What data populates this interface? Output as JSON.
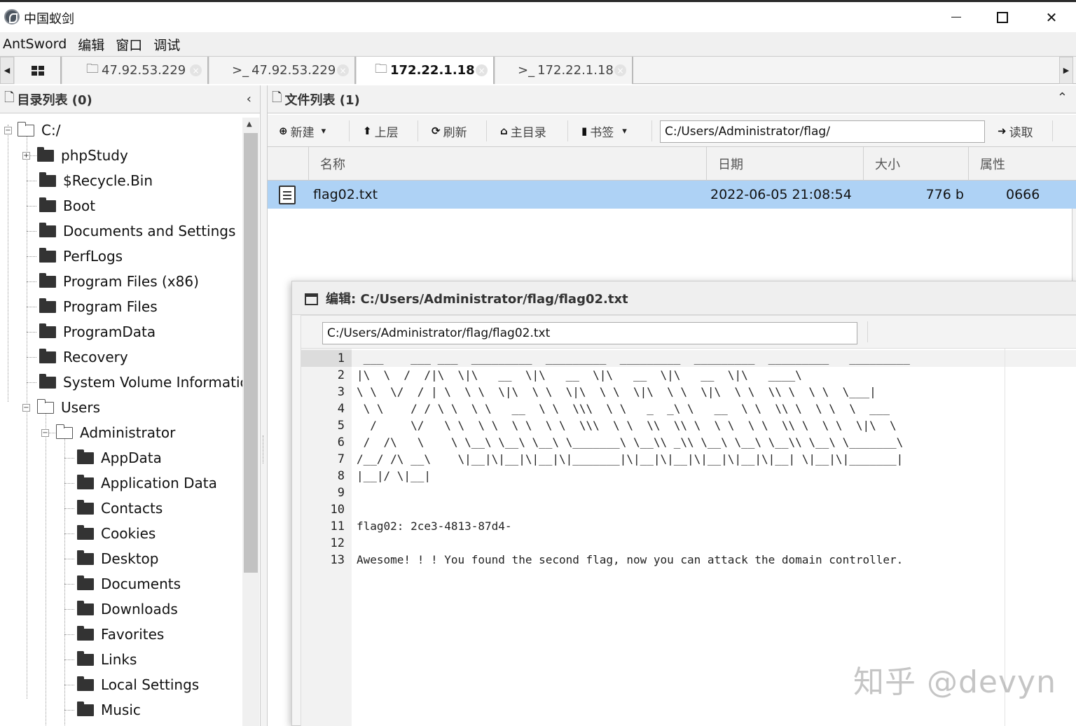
{
  "window": {
    "title": "中国蚁剑",
    "minimize_glyph": "",
    "close_glyph": "✕"
  },
  "menu": [
    "AntSword",
    "编辑",
    "窗口",
    "调试"
  ],
  "tabs": [
    {
      "icon": "🗀",
      "label": "47.92.53.229",
      "close": "×",
      "active": false
    },
    {
      "icon": ">_",
      "label": "47.92.53.229",
      "close": "×",
      "active": false
    },
    {
      "icon": "🗀",
      "label": "172.22.1.18",
      "close": "×",
      "active": true
    },
    {
      "icon": ">_",
      "label": "172.22.1.18",
      "close": "×",
      "active": false
    }
  ],
  "dir_panel": {
    "icon": "🗋",
    "title": "目录列表 (0)",
    "collapse_glyph": "‹"
  },
  "tree": [
    {
      "label": "C:/",
      "level": 0,
      "open": true,
      "expander": "−"
    },
    {
      "label": "phpStudy",
      "level": 1,
      "open": false,
      "expander": "+"
    },
    {
      "label": "$Recycle.Bin",
      "level": 1,
      "open": false
    },
    {
      "label": "Boot",
      "level": 1,
      "open": false
    },
    {
      "label": "Documents and Settings",
      "level": 1,
      "open": false
    },
    {
      "label": "PerfLogs",
      "level": 1,
      "open": false
    },
    {
      "label": "Program Files (x86)",
      "level": 1,
      "open": false
    },
    {
      "label": "Program Files",
      "level": 1,
      "open": false
    },
    {
      "label": "ProgramData",
      "level": 1,
      "open": false
    },
    {
      "label": "Recovery",
      "level": 1,
      "open": false
    },
    {
      "label": "System Volume Information",
      "level": 1,
      "open": false
    },
    {
      "label": "Users",
      "level": 1,
      "open": true,
      "expander": "−"
    },
    {
      "label": "Administrator",
      "level": 2,
      "open": true,
      "expander": "−"
    },
    {
      "label": "AppData",
      "level": 3,
      "open": false
    },
    {
      "label": "Application Data",
      "level": 3,
      "open": false
    },
    {
      "label": "Contacts",
      "level": 3,
      "open": false
    },
    {
      "label": "Cookies",
      "level": 3,
      "open": false
    },
    {
      "label": "Desktop",
      "level": 3,
      "open": false
    },
    {
      "label": "Documents",
      "level": 3,
      "open": false
    },
    {
      "label": "Downloads",
      "level": 3,
      "open": false
    },
    {
      "label": "Favorites",
      "level": 3,
      "open": false
    },
    {
      "label": "Links",
      "level": 3,
      "open": false
    },
    {
      "label": "Local Settings",
      "level": 3,
      "open": false
    },
    {
      "label": "Music",
      "level": 3,
      "open": false
    }
  ],
  "file_panel": {
    "icon": "🗋",
    "title": "文件列表 (1)",
    "collapse_glyph": "⌃"
  },
  "toolbar": {
    "new": {
      "icon": "⊕",
      "label": "新建",
      "caret": "▾"
    },
    "up": {
      "icon": "⬆",
      "label": "上层"
    },
    "refresh": {
      "icon": "⟳",
      "label": "刷新"
    },
    "home": {
      "icon": "⌂",
      "label": "主目录"
    },
    "bookmark": {
      "icon": "▮",
      "label": "书签",
      "caret": "▾"
    },
    "path": "C:/Users/Administrator/flag/",
    "read": {
      "icon": "➜",
      "label": "读取"
    }
  },
  "columns": [
    "名称",
    "日期",
    "大小",
    "属性"
  ],
  "files": [
    {
      "name": "flag02.txt",
      "date": "2022-06-05 21:08:54",
      "size": "776 b",
      "perm": "0666"
    }
  ],
  "editor": {
    "title": "编辑: C:/Users/Administrator/flag/flag02.txt",
    "path": "C:/Users/Administrator/flag/flag02.txt",
    "lines": [
      " ___    ___ ___  _________  _________  _________  _________  _________   _________",
      "|\\  \\  /  /|\\  \\|\\   __  \\|\\   __  \\|\\   __  \\|\\   __  \\|\\   ____\\",
      "\\ \\  \\/  / | \\  \\ \\  \\|\\  \\ \\  \\|\\  \\ \\  \\|\\  \\ \\  \\|\\  \\ \\  \\\\ \\  \\ \\  \\___|",
      " \\ \\    / / \\ \\  \\ \\   __  \\ \\  \\\\\\  \\ \\   _  _\\ \\   __  \\ \\  \\\\ \\  \\ \\  \\  ___",
      "  /     \\/   \\ \\  \\ \\  \\ \\  \\ \\  \\\\\\  \\ \\  \\\\  \\\\ \\  \\ \\  \\ \\  \\\\ \\  \\ \\  \\|\\  \\",
      " /  /\\   \\    \\ \\__\\ \\__\\ \\__\\ \\_______\\ \\__\\\\ _\\\\ \\__\\ \\__\\ \\__\\\\ \\__\\ \\_______\\",
      "/__/ /\\ __\\    \\|__|\\|__|\\|__|\\|_______|\\|__|\\|__|\\|__|\\|__|\\|__| \\|__|\\|_______|",
      "|__|/ \\|__|",
      "",
      "",
      "flag02: 2ce3-4813-87d4-",
      "",
      "Awesome! ! ! You found the second flag, now you can attack the domain controller."
    ]
  },
  "watermark": "知乎 @devyn"
}
